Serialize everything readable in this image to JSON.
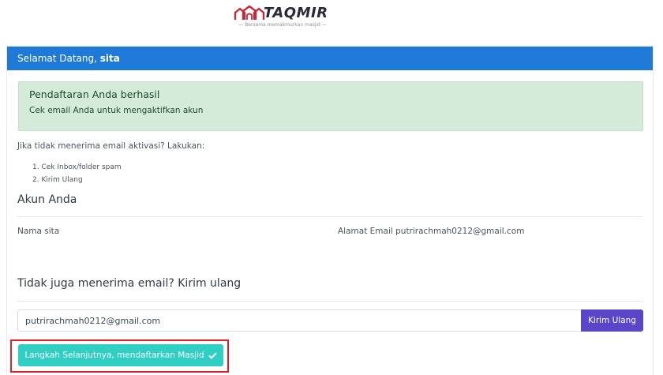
{
  "brand": {
    "name": "TAQMIR",
    "tagline": "Bersama memakmurkan masjid",
    "color": "#c42a3c"
  },
  "header": {
    "greeting": "Selamat Datang,",
    "username": "sita",
    "color": "#1f79d6"
  },
  "alert": {
    "title": "Pendaftaran Anda berhasil",
    "message": "Cek email Anda untuk mengaktifkan akun"
  },
  "instructions": {
    "text": "Jika tidak menerima email aktivasi? Lakukan:",
    "steps": [
      "1. Cek Inbox/folder spam",
      "2. Kirim Ulang"
    ]
  },
  "account": {
    "title": "Akun Anda",
    "name_field": "Nama sita",
    "email_field": "Alamat Email putrirachmah0212@gmail.com"
  },
  "resend": {
    "title": "Tidak juga menerima email? Kirim ulang",
    "email_value": "putrirachmah0212@gmail.com",
    "button_label": "Kirim Ulang",
    "button_color": "#5b45c9"
  },
  "next_step": {
    "button_label": "Langkah Selanjutnya, mendaftarkan Masjid",
    "icon": "check-icon",
    "button_color": "#2fd0c3",
    "highlight_color": "#e1202b"
  }
}
